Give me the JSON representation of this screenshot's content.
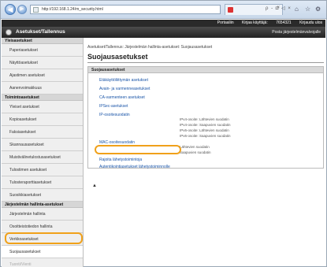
{
  "browser": {
    "url": "http://192.168.1.24/m_security.html",
    "addr_right": "ρ - ◘ ◁ ×",
    "tab_close": "×",
    "home_icon": "home-icon",
    "star_icon": "star-icon",
    "gear_icon": "gear-icon"
  },
  "header": {
    "links": [
      "Portaaliin",
      "Kirjaa käyttäjä:",
      "7654321",
      "Kirjaudu ulos"
    ],
    "app_title": "Asetukset/Tallennus",
    "app_right": "Posta järjestelmänvalvojalle"
  },
  "sidebar": {
    "section1": "Yleisasetukset",
    "items1": [
      "Paperiasetukset",
      "Näyttöasetukset",
      "Ajastimen asetukset",
      "Aanenvoimakkuus"
    ],
    "section2": "Toimintoasetukset",
    "items2": [
      "Yleiset asetukset",
      "Kopioasetukset",
      "Faksiasetukset",
      "Skannausasetukset",
      "Muistivälinetulostusasetukset",
      "Tulostimen asetukset",
      "Tulosteraporttiasetukset",
      "Suosikkiasetukset"
    ],
    "section3": "Järjestelmän hallinta-asetukset",
    "items3": [
      "Järjestelmän hallinta",
      "Osoitteistotiedon hallinta",
      "Verkkoasetukset",
      "Suojausasetukset",
      "Tuonti/Vienti"
    ]
  },
  "main": {
    "breadcrumb": "Asetukset/Tallennus: Järjestelmän hallinta-asetukset: Suojausasetukset",
    "title": "Suojausasetukset",
    "box_header": "Suojausasetukset",
    "links": [
      "Etäkäyttöliittymän asetukset",
      "Avain- ja varmenneasetukset",
      "CA-varmenteen asetukset",
      "IPSec-asetukset",
      "IP-osoitesuodatin",
      "MAC-osoitesuodatin",
      "Rajoita lähetystoimintoja",
      "Autentikointiasetukset lähetystoiminnolle"
    ],
    "ip_filters": [
      "IPv4-osoite: Lähtevien suodatin",
      "IPv4-osoite: Saapuvien suodatin",
      "IPv6-osoite: Lähtevien suodatin",
      "IPv6-osoite: Saapuvien suodatin"
    ],
    "mac_filters": [
      "Lähtevien suodatin",
      "Saapuvien suodatin"
    ],
    "back_to_top": "▲"
  },
  "colors": {
    "highlight": "#f0a11a",
    "link": "#1a55a8"
  }
}
